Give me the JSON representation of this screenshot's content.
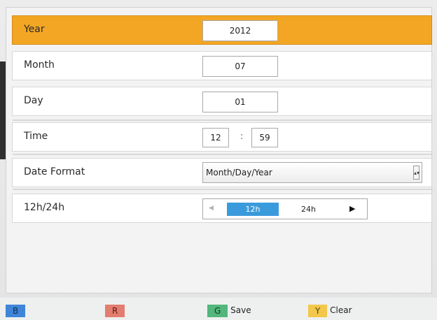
{
  "screen": {
    "rows": [
      {
        "label": "Year",
        "value": "2012"
      },
      {
        "label": "Month",
        "value": "07"
      },
      {
        "label": "Day",
        "value": "01"
      },
      {
        "label": "Time",
        "hour": "12",
        "separator": ":",
        "minute": "59"
      },
      {
        "label": "Date Format",
        "value": "Month/Day/Year"
      },
      {
        "label": "12h/24h",
        "selected": "12h",
        "other": "24h"
      }
    ]
  },
  "footer": {
    "blue_key": "B",
    "red_key": "R",
    "green_key": "G",
    "green_label": "Save",
    "yellow_key": "Y",
    "yellow_label": "Clear"
  },
  "colors": {
    "active_row": "#f3a623",
    "toggle_selected": "#3a9bdc"
  },
  "icons": {
    "left_arrow": "left-arrow-icon",
    "right_arrow": "right-arrow-icon",
    "dropdown": "chevron-down-icon"
  }
}
